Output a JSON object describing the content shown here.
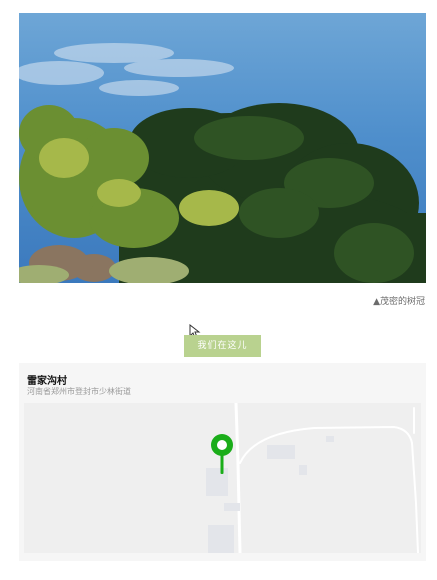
{
  "photo": {
    "alt_icon": "tree-photo",
    "caption": "▲茂密的树冠"
  },
  "action": {
    "button_label": "我们在这儿"
  },
  "location": {
    "name": "雷家沟村",
    "address": "河南省郑州市登封市少林街道",
    "pin_color": "#1aad19"
  },
  "colors": {
    "button_bg": "#b9d28f",
    "map_bg": "#efefef"
  }
}
